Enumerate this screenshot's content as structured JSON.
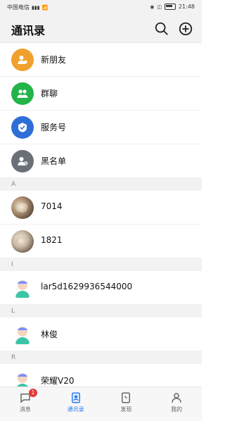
{
  "status_bar": {
    "carrier": "中国电信",
    "time": "21:48"
  },
  "header": {
    "title": "通讯录"
  },
  "functions": [
    {
      "label": "新朋友",
      "color": "#f0a12b"
    },
    {
      "label": "群聊",
      "color": "#23b44a"
    },
    {
      "label": "服务号",
      "color": "#2d6fd6"
    },
    {
      "label": "黑名单",
      "color": "#6b6f78"
    }
  ],
  "sections": [
    {
      "letter": "A",
      "contacts": [
        {
          "name": "7014"
        },
        {
          "name": "1821"
        }
      ]
    },
    {
      "letter": "I",
      "contacts": [
        {
          "name": "lar5d1629936544000"
        }
      ]
    },
    {
      "letter": "L",
      "contacts": [
        {
          "name": "林俊"
        }
      ]
    },
    {
      "letter": "R",
      "contacts": [
        {
          "name": "荣耀V20"
        }
      ]
    }
  ],
  "bottom_nav": {
    "items": [
      {
        "label": "消息",
        "badge": "1"
      },
      {
        "label": "通讯录"
      },
      {
        "label": "发现"
      },
      {
        "label": "我的"
      }
    ],
    "active_color": "#2e7cf6"
  }
}
